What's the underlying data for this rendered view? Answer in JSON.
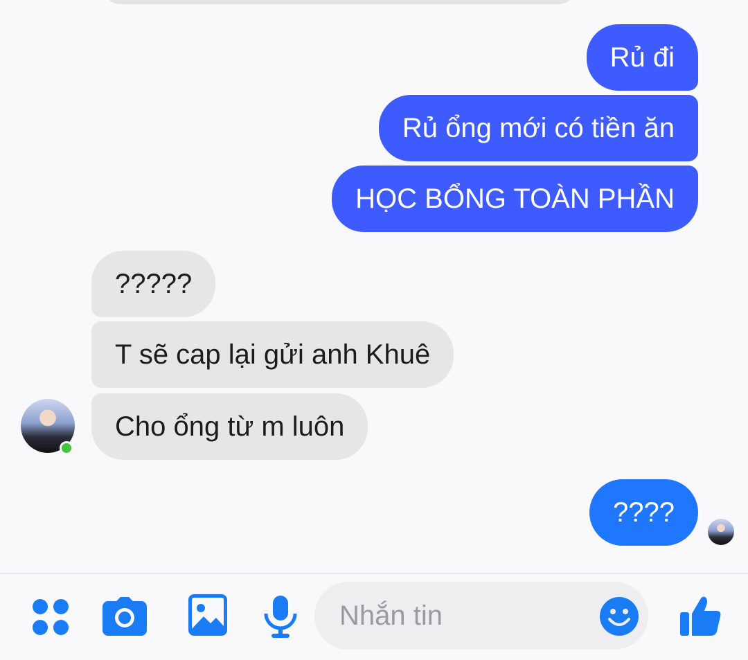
{
  "messages": [
    {
      "sender": "me",
      "text": "Rủ đi"
    },
    {
      "sender": "me",
      "text": "Rủ ổng mới có tiền ăn"
    },
    {
      "sender": "me",
      "text": "HỌC BỔNG TOÀN PHẦN"
    },
    {
      "sender": "other",
      "text": "?????"
    },
    {
      "sender": "other",
      "text": "T sẽ cap lại gửi anh Khuê"
    },
    {
      "sender": "other",
      "text": "Cho ổng từ m luôn"
    },
    {
      "sender": "me",
      "text": "????"
    }
  ],
  "composer": {
    "placeholder": "Nhắn tin"
  },
  "colors": {
    "outgoing_bubble": "#3d5bff",
    "last_outgoing_bubble": "#1f76ff",
    "incoming_bubble": "#e6e6e8",
    "icon_accent": "#1a7cf5",
    "online": "#44c33d"
  },
  "icons": [
    "menu-icon",
    "camera-icon",
    "image-icon",
    "mic-icon",
    "emoji-icon",
    "thumbs-up-icon"
  ]
}
